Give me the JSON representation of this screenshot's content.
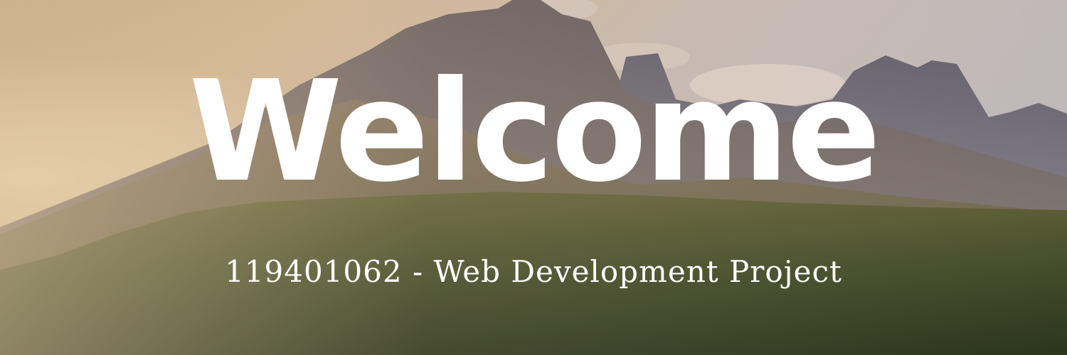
{
  "banner": {
    "title": "Welcome",
    "subtitle": "119401062 - Web Development Project"
  },
  "colors": {
    "text": "#ffffff",
    "sky_warm": "#e6c49a",
    "sky_cool": "#c9c3c6",
    "mountain": "#7d7277",
    "forest": "#3f4a28"
  }
}
